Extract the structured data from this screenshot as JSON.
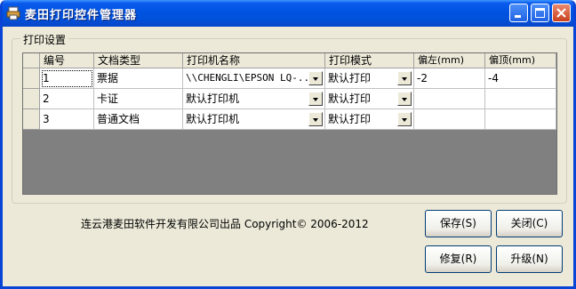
{
  "window": {
    "title": "麦田打印控件管理器"
  },
  "group": {
    "label": "打印设置"
  },
  "grid": {
    "columns": [
      "编号",
      "文档类型",
      "打印机名称",
      "打印模式",
      "偏左(mm)",
      "偏顶(mm)"
    ],
    "rows": [
      {
        "id": "1",
        "doc_type": "票据",
        "printer": "\\\\CHENGLI\\EPSON LQ-...",
        "mode": "默认打印",
        "left": "-2",
        "top": "-4"
      },
      {
        "id": "2",
        "doc_type": "卡证",
        "printer": "默认打印机",
        "mode": "默认打印",
        "left": "",
        "top": ""
      },
      {
        "id": "3",
        "doc_type": "普通文档",
        "printer": "默认打印机",
        "mode": "默认打印",
        "left": "",
        "top": ""
      }
    ]
  },
  "footer": {
    "copyright": "连云港麦田软件开发有限公司出品 Copyright© 2006-2012"
  },
  "buttons": {
    "save": "保存(S)",
    "close": "关闭(C)",
    "repair": "修复(R)",
    "upgrade": "升级(N)"
  }
}
